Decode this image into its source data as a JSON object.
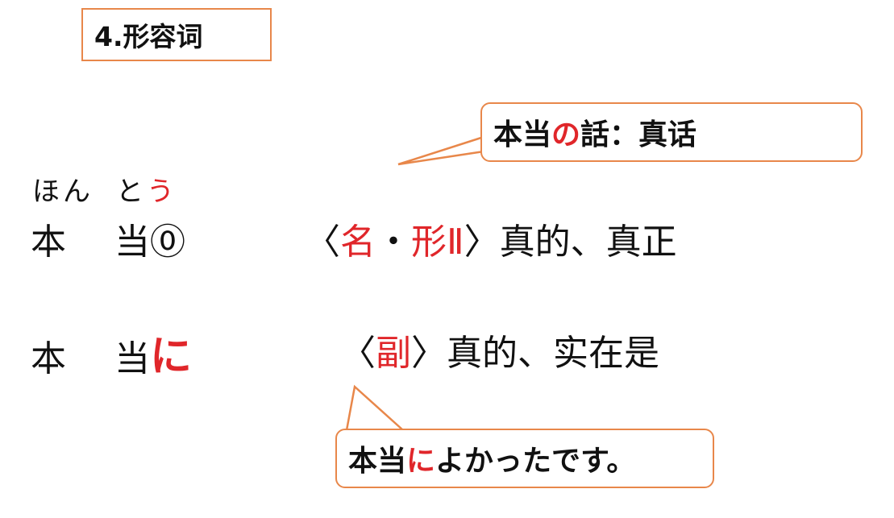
{
  "title": "4.形容词",
  "callout_top": {
    "part1": "本当",
    "part2": "の",
    "part3": "話：真话"
  },
  "reading": {
    "hon": "ほん",
    "to": "と",
    "u": "う"
  },
  "entry1": {
    "k1": "本",
    "k2": "当⓪",
    "bracket_open": "〈",
    "pos_noun": "名",
    "dot": "・",
    "pos_adj": "形Ⅱ",
    "bracket_close": "〉",
    "meaning": "真的、真正"
  },
  "entry2": {
    "k1": "本",
    "k2": "当",
    "particle": "に",
    "bracket_open": "〈",
    "pos": "副",
    "bracket_close": "〉",
    "meaning": "真的、实在是"
  },
  "callout_bottom": {
    "part1": "本当",
    "part2": "に",
    "part3": "よかったです。"
  },
  "colors": {
    "accent_red": "#e0262a",
    "border_orange": "#e8874a"
  }
}
